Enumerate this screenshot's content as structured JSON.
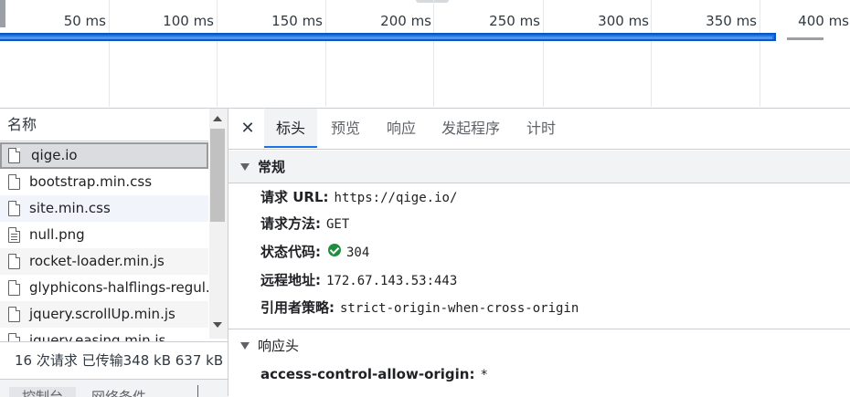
{
  "timeline": {
    "ticks": [
      "50 ms",
      "100 ms",
      "150 ms",
      "200 ms",
      "250 ms",
      "300 ms",
      "350 ms",
      "400 ms"
    ]
  },
  "requests": {
    "header": "名称",
    "items": [
      "qige.io",
      "bootstrap.min.css",
      "site.min.css",
      "null.png",
      "rocket-loader.min.js",
      "glyphicons-halflings-regul.",
      "jquery.scrollUp.min.js",
      "jquery.easing.min.js"
    ],
    "status": "16 次请求  已传输348 kB  637 kB"
  },
  "bottom_tabs": {
    "console": "控制台",
    "network_conditions": "网络条件"
  },
  "details": {
    "tabs": [
      "标头",
      "预览",
      "响应",
      "发起程序",
      "计时"
    ],
    "general": {
      "title": "常规",
      "url_label": "请求 URL:",
      "url_value": "https://qige.io/",
      "method_label": "请求方法:",
      "method_value": "GET",
      "status_label": "状态代码:",
      "status_value": "304",
      "remote_label": "远程地址:",
      "remote_value": "172.67.143.53:443",
      "referrer_label": "引用者策略:",
      "referrer_value": "strict-origin-when-cross-origin"
    },
    "response_headers": {
      "title": "响应头",
      "first_key": "access-control-allow-origin:",
      "first_value": "*"
    }
  },
  "colors": {
    "accent": "#1a73e8",
    "status_ok": "#1e8e3e"
  }
}
